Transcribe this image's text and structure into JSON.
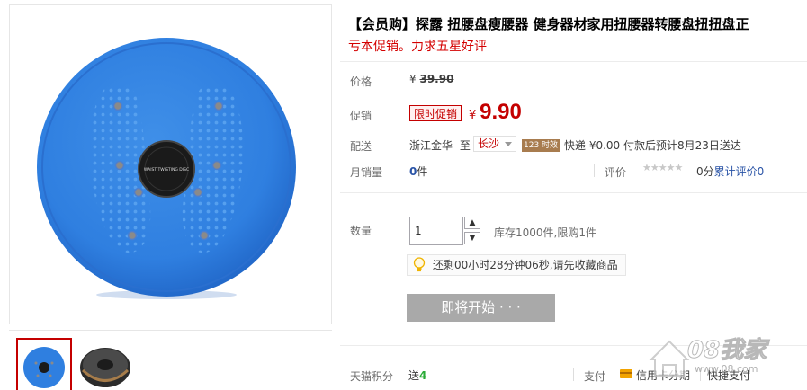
{
  "product": {
    "title": "【会员购】探露 扭腰盘瘦腰器 健身器材家用扭腰器转腰盘扭扭盘正",
    "subtitle": "亏本促销。力求五星好评",
    "disc_label": "WAIST TWISTING DISC"
  },
  "price": {
    "label": "价格",
    "currency": "¥",
    "original": "39.90"
  },
  "promo": {
    "label": "促销",
    "tag": "限时促销",
    "currency": "¥",
    "price": "9.90"
  },
  "delivery": {
    "label": "配送",
    "from": "浙江金华",
    "to_word": "至",
    "destination": "长沙",
    "badge": "123 时效",
    "info": "快递 ¥0.00 付款后预计8月23日送达"
  },
  "sales": {
    "label": "月销量",
    "count": "0",
    "unit": "件",
    "review_label": "评价",
    "stars": "★★★★★",
    "score": "0分",
    "review_link": "累计评价0"
  },
  "quantity": {
    "label": "数量",
    "value": "1",
    "up": "▲",
    "down": "▼",
    "stock": "库存1000件,限购1件"
  },
  "countdown": {
    "text": "还剩00小时28分钟06秒,请先收藏商品"
  },
  "buy_button": {
    "label": "即将开始 · · ·"
  },
  "points": {
    "label": "天猫积分",
    "prefix": "送",
    "value": "4"
  },
  "payment": {
    "label": "支付",
    "method1": "信用卡分期",
    "method2": "快捷支付"
  },
  "watermark": {
    "brand": "08我家",
    "url": "www.08.com"
  },
  "colors": {
    "accent": "#c40000",
    "link": "#2953a6",
    "disc_blue": "#2f7fe0",
    "button_disabled": "#a9a9a9"
  }
}
